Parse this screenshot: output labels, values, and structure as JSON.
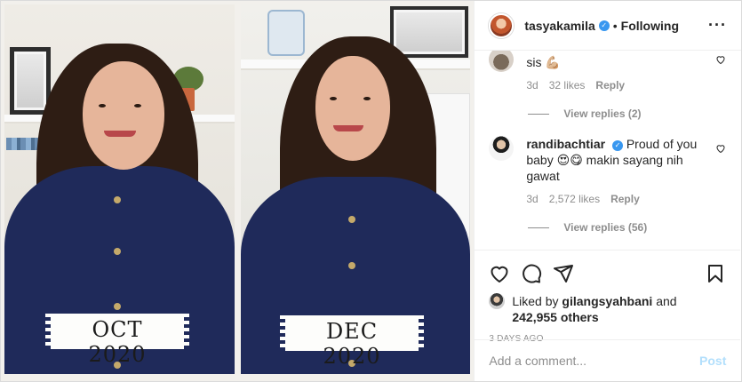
{
  "post": {
    "author": {
      "username": "tasyakamila",
      "verified": true,
      "follow_status": "Following"
    },
    "more_icon": "more-horizontal-icon",
    "media": {
      "labels": [
        "OCT 2020",
        "DEC 2020"
      ]
    },
    "comments": [
      {
        "text": "sis 💪🏼",
        "age": "3d",
        "likes": "32 likes",
        "reply_label": "Reply",
        "view_replies": "View replies (2)"
      },
      {
        "username": "randibachtiar",
        "verified": true,
        "text": "Proud of you baby 😍😋 makin sayang nih gawat",
        "age": "3d",
        "likes": "2,572 likes",
        "reply_label": "Reply",
        "view_replies": "View replies (56)"
      }
    ],
    "actions": {
      "like_icon": "heart-icon",
      "comment_icon": "comment-icon",
      "share_icon": "share-icon",
      "save_icon": "bookmark-icon"
    },
    "liked_by": {
      "prefix": "Liked by ",
      "user": "gilangsyahbani",
      "middle": " and",
      "count": "242,955 others"
    },
    "timestamp": "3 DAYS AGO",
    "add_comment": {
      "placeholder": "Add a comment...",
      "post_label": "Post"
    }
  }
}
